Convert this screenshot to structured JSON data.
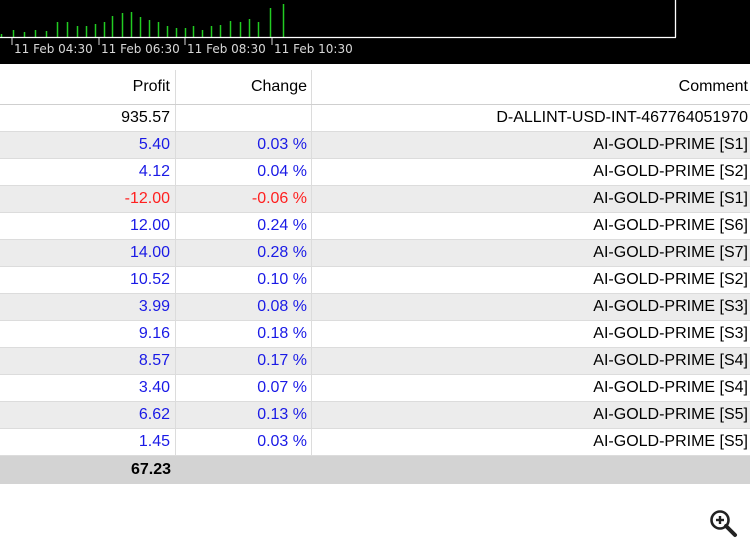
{
  "chart": {
    "time_labels": [
      "11 Feb 04:30",
      "11 Feb 06:30",
      "11 Feb 08:30",
      "11 Feb 10:30"
    ],
    "bar_color": "#22cc22"
  },
  "table": {
    "headers": {
      "profit": "Profit",
      "change": "Change",
      "comment": "Comment"
    },
    "rows": [
      {
        "profit": "935.57",
        "change": "",
        "comment": "D-ALLINT-USD-INT-467764051970",
        "color": "black"
      },
      {
        "profit": "5.40",
        "change": "0.03 %",
        "comment": "AI-GOLD-PRIME [S1]",
        "color": "blue"
      },
      {
        "profit": "4.12",
        "change": "0.04 %",
        "comment": "AI-GOLD-PRIME [S2]",
        "color": "blue"
      },
      {
        "profit": "-12.00",
        "change": "-0.06 %",
        "comment": "AI-GOLD-PRIME [S1]",
        "color": "red"
      },
      {
        "profit": "12.00",
        "change": "0.24 %",
        "comment": "AI-GOLD-PRIME [S6]",
        "color": "blue"
      },
      {
        "profit": "14.00",
        "change": "0.28 %",
        "comment": "AI-GOLD-PRIME [S7]",
        "color": "blue"
      },
      {
        "profit": "10.52",
        "change": "0.10 %",
        "comment": "AI-GOLD-PRIME [S2]",
        "color": "blue"
      },
      {
        "profit": "3.99",
        "change": "0.08 %",
        "comment": "AI-GOLD-PRIME [S3]",
        "color": "blue"
      },
      {
        "profit": "9.16",
        "change": "0.18 %",
        "comment": "AI-GOLD-PRIME [S3]",
        "color": "blue"
      },
      {
        "profit": "8.57",
        "change": "0.17 %",
        "comment": "AI-GOLD-PRIME [S4]",
        "color": "blue"
      },
      {
        "profit": "3.40",
        "change": "0.07 %",
        "comment": "AI-GOLD-PRIME [S4]",
        "color": "blue"
      },
      {
        "profit": "6.62",
        "change": "0.13 %",
        "comment": "AI-GOLD-PRIME [S5]",
        "color": "blue"
      },
      {
        "profit": "1.45",
        "change": "0.03 %",
        "comment": "AI-GOLD-PRIME [S5]",
        "color": "blue"
      }
    ],
    "total": {
      "profit": "67.23"
    }
  },
  "icons": {
    "zoom": "zoom-in-icon"
  }
}
